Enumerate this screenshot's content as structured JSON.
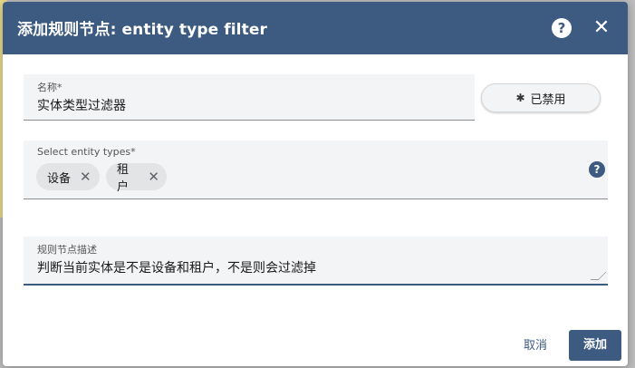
{
  "dialog": {
    "title": "添加规则节点: entity type filter",
    "help_icon": "?",
    "close_icon": "✕"
  },
  "name_field": {
    "label": "名称*",
    "value": "实体类型过滤器"
  },
  "disabled_button": {
    "icon": "bug-icon",
    "label": "已禁用"
  },
  "entity_types": {
    "label": "Select entity types*",
    "chips": [
      {
        "label": "设备",
        "remove_icon": "✕"
      },
      {
        "label": "租户",
        "remove_icon": "✕"
      }
    ],
    "help_icon": "?"
  },
  "description_field": {
    "label": "规则节点描述",
    "value": "判断当前实体是不是设备和租户，不是则会过滤掉"
  },
  "actions": {
    "cancel_label": "取消",
    "add_label": "添加"
  },
  "colors": {
    "header": "#3d5a80",
    "accent": "#3d5a80"
  }
}
